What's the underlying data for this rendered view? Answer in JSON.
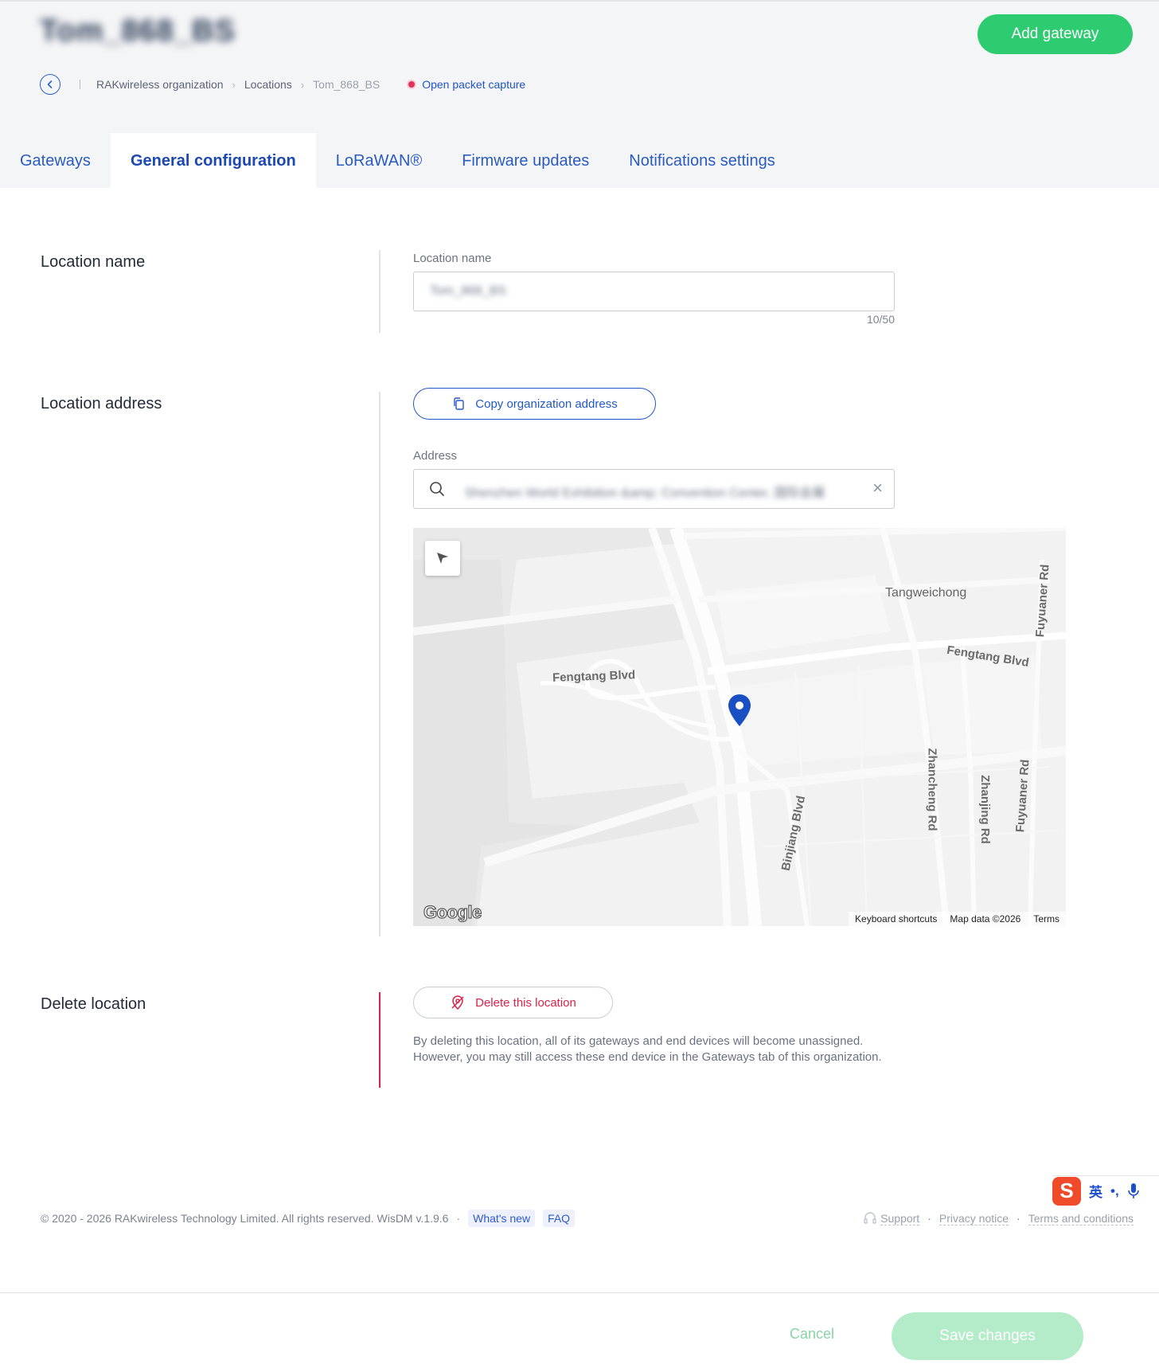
{
  "header": {
    "title": "Tom_868_BS",
    "add_button": "Add gateway",
    "breadcrumb": {
      "org": "RAKwireless organization",
      "locations": "Locations",
      "current": "Tom_868_BS",
      "packet_capture": "Open packet capture"
    },
    "tabs": [
      {
        "label": "Gateways",
        "active": false
      },
      {
        "label": "General configuration",
        "active": true
      },
      {
        "label": "LoRaWAN®",
        "active": false
      },
      {
        "label": "Firmware updates",
        "active": false
      },
      {
        "label": "Notifications settings",
        "active": false
      }
    ]
  },
  "location_name": {
    "section_title": "Location name",
    "field_label": "Location name",
    "value": "Tom_868_BS",
    "counter": "10/50"
  },
  "location_address": {
    "section_title": "Location address",
    "copy_button": "Copy organization address",
    "field_label": "Address",
    "value": "Shenzhen World Exhibition &amp; Convention Center, 国际会展"
  },
  "map": {
    "labels": {
      "tangweichong": "Tangweichong",
      "fengtang_left": "Fengtang Blvd",
      "fengtang_right": "Fengtang Blvd",
      "fuyuaner_top": "Fuyuaner Rd",
      "fuyuaner_bottom": "Fuyuaner Rd",
      "zhancheng": "Zhancheng Rd",
      "zhanjing": "Zhanjing Rd",
      "binjiang": "Binjiang Blvd"
    },
    "logo": "Google",
    "attribution": {
      "shortcuts": "Keyboard shortcuts",
      "data": "Map data ©2026",
      "terms": "Terms"
    },
    "pin_color": "#1a4fc4"
  },
  "delete_location": {
    "section_title": "Delete location",
    "button": "Delete this location",
    "description": "By deleting this location, all of its gateways and end devices will become unassigned. However, you may still access these end device in the Gateways tab of this organization."
  },
  "footer": {
    "copyright": "© 2020 - 2026 RAKwireless Technology Limited. All rights reserved. WisDM v.1.9.6",
    "whats_new": "What's new",
    "faq": "FAQ",
    "support": "Support",
    "privacy": "Privacy notice",
    "terms": "Terms and conditions"
  },
  "ime": {
    "logo": "S",
    "lang": "英",
    "punct": "•,"
  },
  "actions": {
    "cancel": "Cancel",
    "save": "Save changes"
  },
  "colors": {
    "accent_green": "#2ecc71",
    "link_blue": "#1f55c9",
    "danger_red": "#d9234a",
    "save_disabled": "#b4ecc9"
  }
}
